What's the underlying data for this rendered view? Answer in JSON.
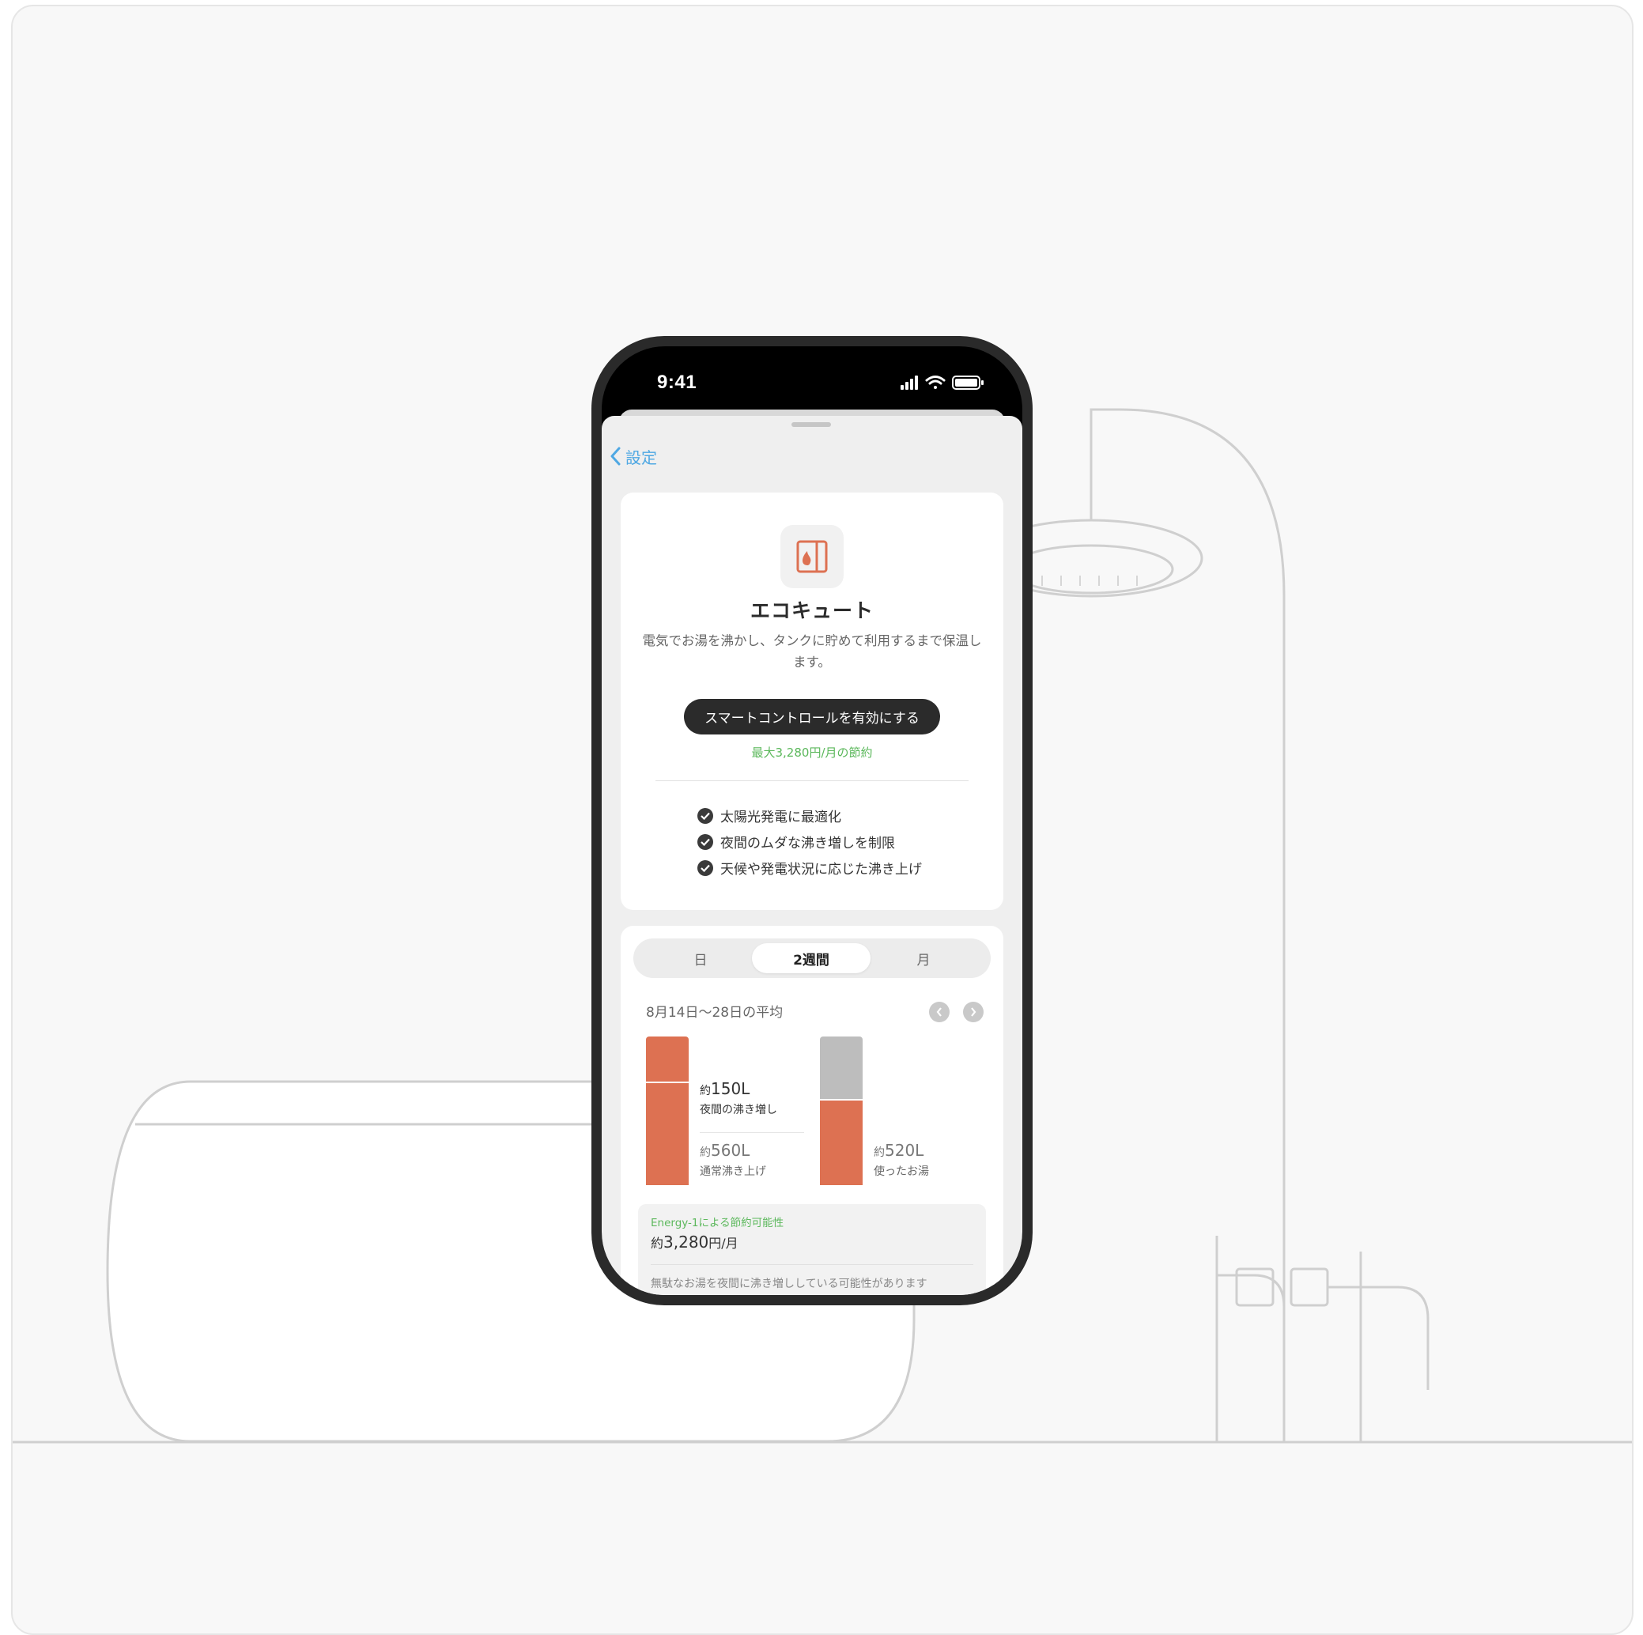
{
  "status_bar": {
    "time": "9:41"
  },
  "nav": {
    "back_label": "設定"
  },
  "device_card": {
    "title": "エコキュート",
    "description": "電気でお湯を沸かし、タンクに貯めて利用するまで保温します。",
    "cta_label": "スマートコントロールを有効にする",
    "saving_note": "最大3,280円/月の節約",
    "features": [
      "太陽光発電に最適化",
      "夜間のムダな沸き増しを制限",
      "天候や発電状況に応じた沸き上げ"
    ]
  },
  "usage_card": {
    "tabs": [
      "日",
      "2週間",
      "月"
    ],
    "active_tab": "2週間",
    "period_label": "8月14日〜28日の平均",
    "left": {
      "night_prefix": "約",
      "night_value": "150L",
      "night_caption": "夜間の沸き増し",
      "normal_prefix": "約",
      "normal_value": "560L",
      "normal_caption": "通常沸き上げ"
    },
    "right": {
      "used_prefix": "約",
      "used_value": "520L",
      "used_caption": "使ったお湯"
    },
    "energy": {
      "heading": "Energy-1による節約可能性",
      "value_prefix": "約",
      "value": "3,280",
      "value_unit": "円/月",
      "note": "無駄なお湯を夜間に沸き増ししている可能性があります"
    }
  },
  "colors": {
    "accent_orange": "#dd7152",
    "grey_bar": "#bdbdbd",
    "green": "#5cb85c",
    "link_blue": "#4fa8e3"
  },
  "icons": [
    "back-chevron-icon",
    "signal-icon",
    "wifi-icon",
    "battery-icon",
    "water-heater-icon",
    "check-icon",
    "chevron-left-icon",
    "chevron-right-icon"
  ]
}
